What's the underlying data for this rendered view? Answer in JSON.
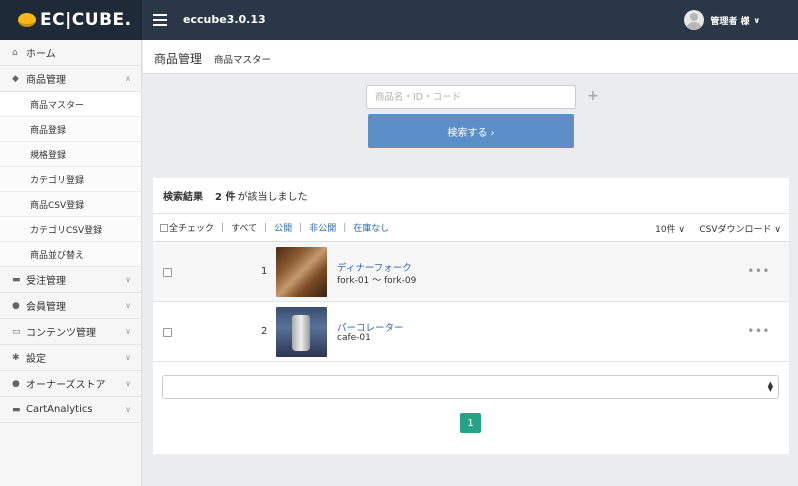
{
  "brand": {
    "logo_text": "EC|CUBE.",
    "version": "eccube3.0.13"
  },
  "user": {
    "name": "管理者 様",
    "chevron": "∨"
  },
  "sidebar": {
    "home": "ホーム",
    "product_mgmt": "商品管理",
    "product_sub": [
      "商品マスター",
      "商品登録",
      "規格登録",
      "カテゴリ登録",
      "商品CSV登録",
      "カテゴリCSV登録",
      "商品並び替え"
    ],
    "order_mgmt": "受注管理",
    "member_mgmt": "会員管理",
    "content_mgmt": "コンテンツ管理",
    "settings": "設定",
    "owners_store": "オーナーズストア",
    "cart_analytics": "CartAnalytics"
  },
  "header": {
    "title": "商品管理",
    "subtitle": "商品マスター"
  },
  "search": {
    "placeholder": "商品名・ID・コード",
    "plus": "+",
    "button_label": "検索する ›"
  },
  "results": {
    "label": "検索結果",
    "count": "2 件",
    "count_suffix": "が該当しました",
    "filter": {
      "check_all": "全チェック",
      "all": "すべて",
      "public": "公開",
      "private": "非公開",
      "out_of_stock": "在庫なし",
      "per_page": "10件 ∨",
      "csv_download": "CSVダウンロード ∨"
    },
    "rows": [
      {
        "num": "1",
        "name": "ディナーフォーク",
        "code": "fork-01 ～ fork-09",
        "more": "•••"
      },
      {
        "num": "2",
        "name": "パーコレーター",
        "code": "cafe-01",
        "more": "•••"
      }
    ],
    "pager": "1"
  },
  "colors": {
    "topbar": "#2a3746",
    "accent_button": "#5c8ec7",
    "pager": "#26a387",
    "link": "#2c6ab0"
  }
}
